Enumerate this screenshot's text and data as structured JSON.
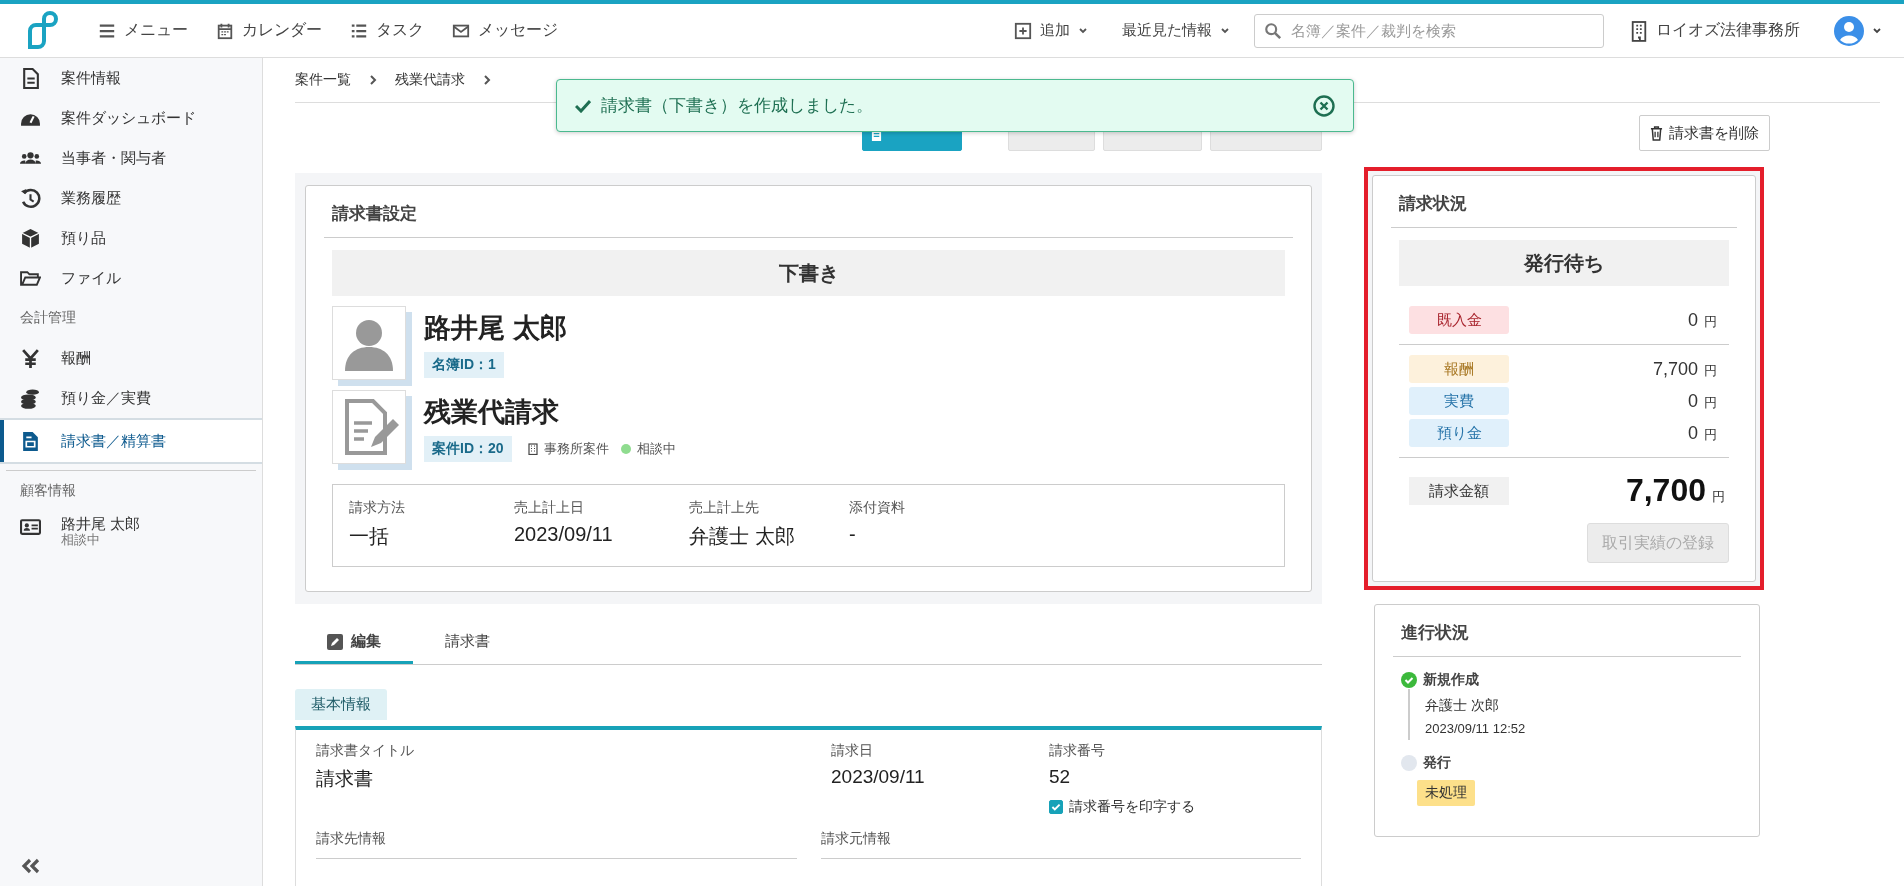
{
  "header": {
    "nav": [
      {
        "label": "メニュー"
      },
      {
        "label": "カレンダー"
      },
      {
        "label": "タスク"
      },
      {
        "label": "メッセージ"
      }
    ],
    "add": "追加",
    "recent": "最近見た情報",
    "search": {
      "placeholder": "名簿／案件／裁判を検索"
    },
    "office": "ロイオズ法律事務所"
  },
  "sidebar": {
    "items": [
      {
        "kind": "item",
        "label": "案件情報",
        "selected": false
      },
      {
        "kind": "item",
        "label": "案件ダッシュボード",
        "selected": false
      },
      {
        "kind": "item",
        "label": "当事者・関与者",
        "selected": false
      },
      {
        "kind": "item",
        "label": "業務履歴",
        "selected": false
      },
      {
        "kind": "item",
        "label": "預り品",
        "selected": false
      },
      {
        "kind": "item",
        "label": "ファイル",
        "selected": false
      },
      {
        "kind": "heading",
        "label": "会計管理"
      },
      {
        "kind": "item",
        "label": "報酬",
        "selected": false
      },
      {
        "kind": "item",
        "label": "預り金／実費",
        "selected": false
      },
      {
        "kind": "item",
        "label": "請求書／精算書",
        "selected": true
      },
      {
        "kind": "heading",
        "label": "顧客情報"
      },
      {
        "kind": "client",
        "label": "路井尾 太郎",
        "sub": "相談中",
        "selected": false
      }
    ]
  },
  "breadcrumb": [
    "案件一覧",
    "残業代請求"
  ],
  "toast": {
    "message": "請求書（下書き）を作成しました。"
  },
  "actions": [
    {
      "kind": "primary",
      "disabled": false
    },
    {
      "kind": "plain",
      "disabled": true
    },
    {
      "kind": "plain",
      "disabled": true
    },
    {
      "kind": "plain",
      "disabled": true
    }
  ],
  "delete_button": "請求書を削除",
  "settings": {
    "title": "請求書設定",
    "status": "下書き",
    "client": {
      "name": "路井尾 太郎",
      "id": "名簿ID：1"
    },
    "case": {
      "title": "残業代請求",
      "id": "案件ID：20",
      "office": "事務所案件",
      "status": "相談中",
      "color": "#8fdc8f"
    },
    "fields": [
      {
        "label": "請求方法",
        "value": "一括"
      },
      {
        "label": "売上計上日",
        "value": "2023/09/11"
      },
      {
        "label": "売上計上先",
        "value": "弁護士 太郎"
      },
      {
        "label": "添付資料",
        "value": "-"
      }
    ]
  },
  "tabs": [
    {
      "label": "編集",
      "selected": true
    },
    {
      "label": "請求書",
      "selected": false
    }
  ],
  "section": "基本情報",
  "basic": {
    "title": {
      "label": "請求書タイトル",
      "value": "請求書"
    },
    "date": {
      "label": "請求日",
      "value": "2023/09/11"
    },
    "number": {
      "label": "請求番号",
      "value": "52",
      "print_label": "請求番号を印字する",
      "checked": true
    },
    "to_label": "請求先情報",
    "from_label": "請求元情報"
  },
  "billing": {
    "title": "請求状況",
    "highlighted": true,
    "status": "発行待ち",
    "groups": [
      [
        {
          "label": "既入金",
          "color": "#fde0e2",
          "value": "0",
          "unit": "円"
        }
      ],
      [
        {
          "label": "報酬",
          "color": "#fdf1dc",
          "value": "7,700",
          "unit": "円"
        },
        {
          "label": "実費",
          "color": "#e0f0fb",
          "value": "0",
          "unit": "円"
        },
        {
          "label": "預り金",
          "color": "#e0f0fb",
          "value": "0",
          "unit": "円"
        }
      ]
    ],
    "total": {
      "label": "請求金額",
      "value": "7,700",
      "unit": "円"
    },
    "button": {
      "label": "取引実績の登録",
      "disabled": true
    }
  },
  "progress": {
    "title": "進行状況",
    "steps": [
      {
        "label": "新規作成",
        "done": true,
        "person": "弁護士 次郎",
        "datetime": "2023/09/11 12:52"
      },
      {
        "label": "発行",
        "done": false,
        "badge": "未処理"
      }
    ]
  }
}
